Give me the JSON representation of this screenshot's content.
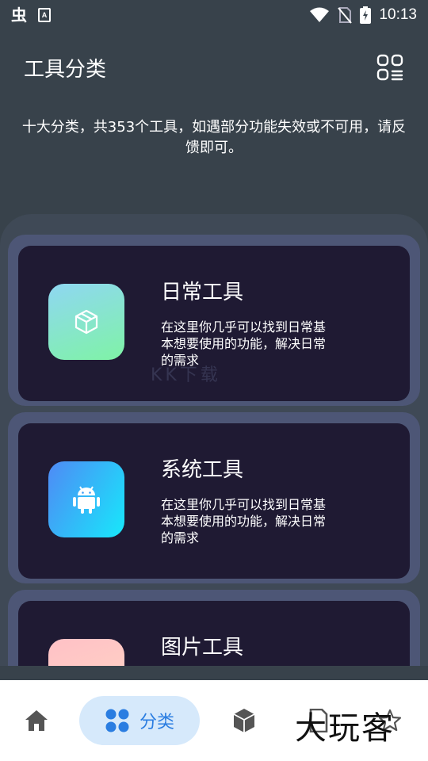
{
  "status_bar": {
    "time": "10:13",
    "app_glyph": "虫",
    "a_badge": "A",
    "icons": [
      "wifi-icon",
      "no-sim-icon",
      "battery-charging-icon"
    ]
  },
  "header": {
    "title": "工具分类",
    "action_icon": "grid-list-icon"
  },
  "intro": "十大分类，共353个工具，如遇部分功能失效或不可用，请反馈即可。",
  "categories": [
    {
      "title": "日常工具",
      "desc": "在这里你几乎可以找到日常基本想要使用的功能，解决日常的需求",
      "icon": "cube-icon",
      "gradient": [
        "#8fd7f2",
        "#7ff3a6"
      ]
    },
    {
      "title": "系统工具",
      "desc": "在这里你几乎可以找到日常基本想要使用的功能，解决日常的需求",
      "icon": "android-icon",
      "gradient": [
        "#4f8af5",
        "#17e8fb"
      ]
    },
    {
      "title": "图片工具",
      "desc": "",
      "icon": "image-icon",
      "gradient": [
        "#ffc1c6",
        "#ffd7c4"
      ]
    }
  ],
  "watermark": "KK下载",
  "bottom_nav": {
    "items": [
      {
        "name": "home",
        "icon": "home-icon"
      },
      {
        "name": "category",
        "icon": "category-grid-icon",
        "label": "分类",
        "active": true
      },
      {
        "name": "cube",
        "icon": "cube-nav-icon"
      },
      {
        "name": "file",
        "icon": "file-icon"
      },
      {
        "name": "star",
        "icon": "star-icon"
      }
    ]
  },
  "brand": "大玩客",
  "colors": {
    "background": "#38424b",
    "card": "#1f1a33",
    "accent": "#2a7de1",
    "nav_active_bg": "#d6e9fb"
  }
}
